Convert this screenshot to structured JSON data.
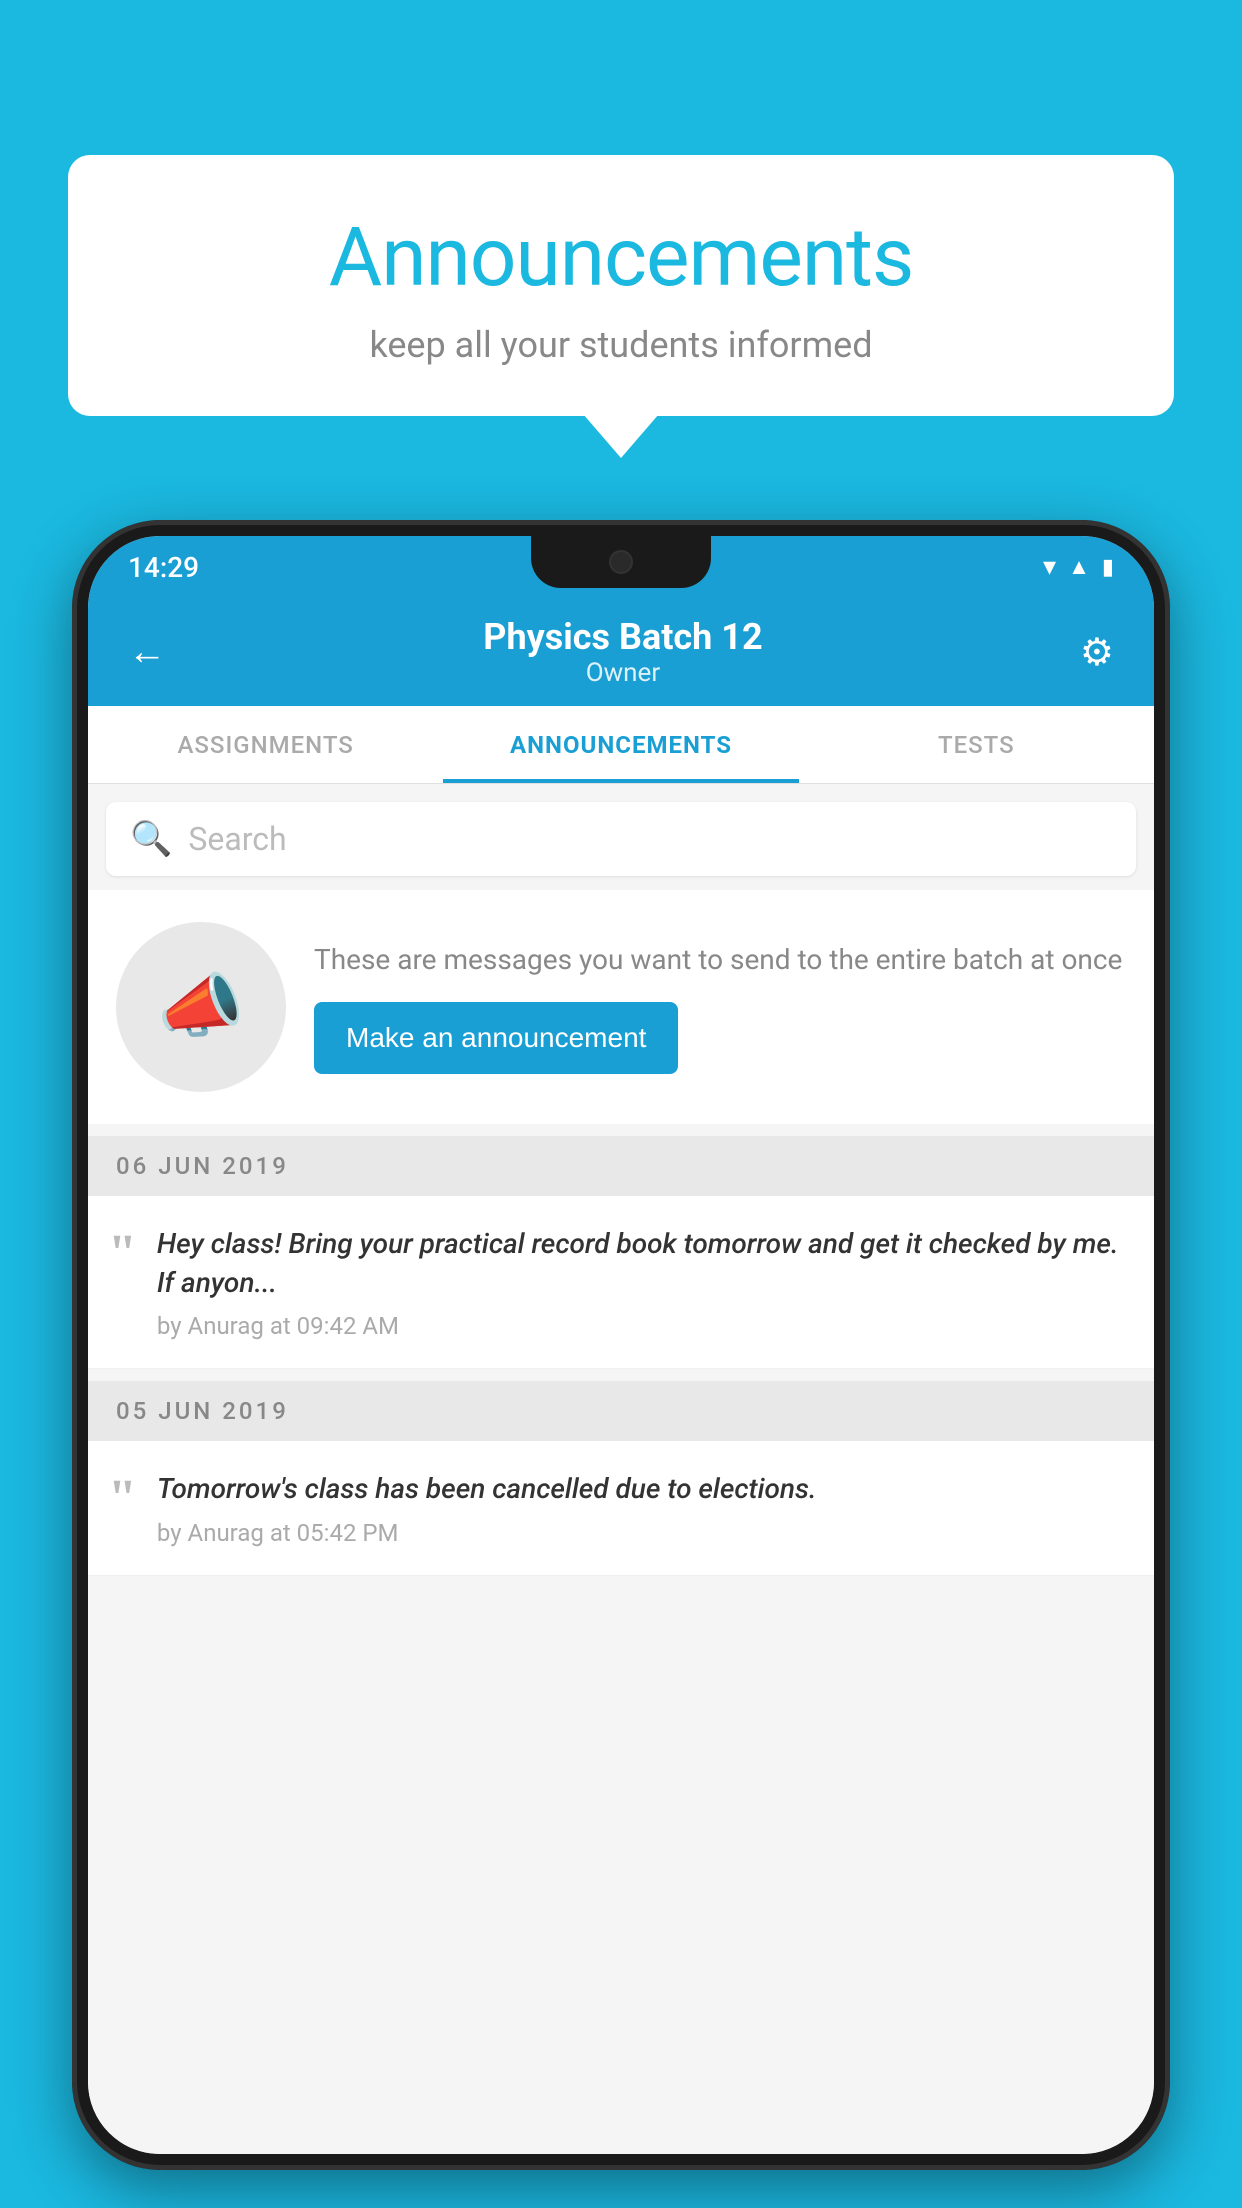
{
  "background_color": "#1bb8e0",
  "speech_bubble": {
    "title": "Announcements",
    "subtitle": "keep all your students informed"
  },
  "phone": {
    "status_bar": {
      "time": "14:29",
      "wifi_icon": "wifi",
      "signal_icon": "signal",
      "battery_icon": "battery"
    },
    "header": {
      "back_label": "←",
      "title": "Physics Batch 12",
      "subtitle": "Owner",
      "settings_icon": "⚙"
    },
    "tabs": [
      {
        "label": "ASSIGNMENTS",
        "active": false
      },
      {
        "label": "ANNOUNCEMENTS",
        "active": true
      },
      {
        "label": "TESTS",
        "active": false
      }
    ],
    "search": {
      "placeholder": "Search"
    },
    "promo": {
      "description": "These are messages you want to send to the entire batch at once",
      "button_label": "Make an announcement"
    },
    "announcements": [
      {
        "date_label": "06  JUN  2019",
        "message": "Hey class! Bring your practical record book tomorrow and get it checked by me. If anyon...",
        "meta": "by Anurag at 09:42 AM"
      },
      {
        "date_label": "05  JUN  2019",
        "message": "Tomorrow's class has been cancelled due to elections.",
        "meta": "by Anurag at 05:42 PM"
      }
    ]
  }
}
